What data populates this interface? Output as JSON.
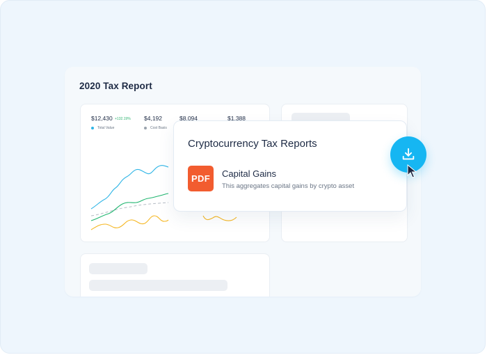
{
  "report": {
    "title": "2020 Tax Report"
  },
  "stats": {
    "total_value": "$12,430",
    "total_value_change": "+132.19%",
    "cost_basis": "$4,192",
    "third_value": "$8,094",
    "fourth_value": "$1,388"
  },
  "legend": {
    "total_value_label": "Total Value",
    "cost_basis_label": "Cost Basis",
    "colors": {
      "total_value": "#2fb5e6",
      "cost_basis": "#9aa3ad"
    }
  },
  "line_colors": {
    "blue": "#2fb5e6",
    "green": "#1fb56f",
    "yellow": "#f5b620",
    "gray_dashed": "#b5bcc4"
  },
  "popup": {
    "title": "Cryptocurrency Tax Reports",
    "file_badge": "PDF",
    "item_title": "Capital Gains",
    "item_description": "This aggregates capital gains by crypto asset",
    "icons": [
      "pdf-icon",
      "download-icon",
      "cursor-pointer-icon"
    ]
  },
  "accent": "#16b6f2",
  "pdf_color": "#f25c2f"
}
